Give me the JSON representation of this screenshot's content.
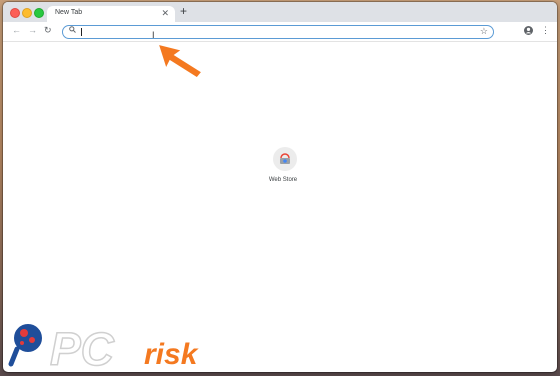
{
  "tabs": [
    {
      "title": "New Tab"
    }
  ],
  "tab_close_glyph": "✕",
  "new_tab_glyph": "+",
  "toolbar": {
    "back_glyph": "←",
    "forward_glyph": "→",
    "reload_glyph": "↻",
    "omnibox": {
      "value": "",
      "search_icon": "search-icon",
      "star_icon": "star-icon"
    },
    "menu_glyph": "⋮"
  },
  "shortcuts": [
    {
      "label": "Web Store"
    }
  ],
  "watermark": {
    "text_pc": "PC",
    "text_risk": "risk"
  },
  "colors": {
    "accent": "#f47920",
    "omnibox_border": "#5b9bd5"
  }
}
